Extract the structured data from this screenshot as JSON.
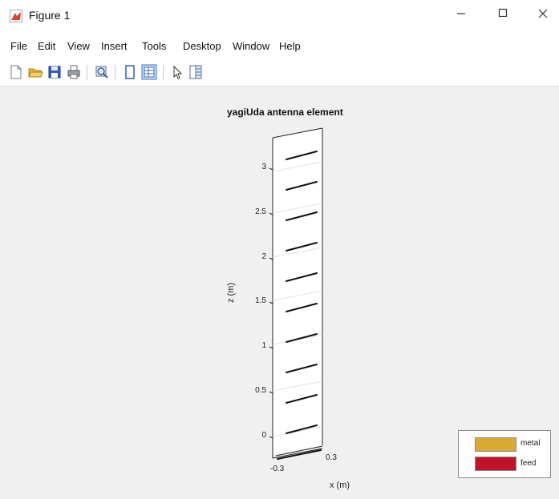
{
  "window": {
    "title": "Figure 1"
  },
  "menu": {
    "items": [
      "File",
      "Edit",
      "View",
      "Insert",
      "Tools",
      "Desktop",
      "Window",
      "Help"
    ]
  },
  "toolbar": {
    "icons": [
      "new-figure-icon",
      "open-file-icon",
      "save-icon",
      "print-icon",
      "zoom-icon",
      "property-inspector-icon",
      "plot-browser-icon",
      "select-arrow-icon",
      "legend-toggle-icon"
    ]
  },
  "plot": {
    "title": "yagiUda antenna element",
    "xlabel": "x (m)",
    "zlabel": "z (m)",
    "z_ticks": [
      "3",
      "2.5",
      "2",
      "1.5",
      "1",
      "0.5",
      "0"
    ],
    "x_ticks": [
      "-0.3",
      "0.3"
    ]
  },
  "legend": {
    "entries": [
      {
        "label": "metal",
        "color": "#d9a934"
      },
      {
        "label": "feed",
        "color": "#c0132a"
      }
    ]
  }
}
